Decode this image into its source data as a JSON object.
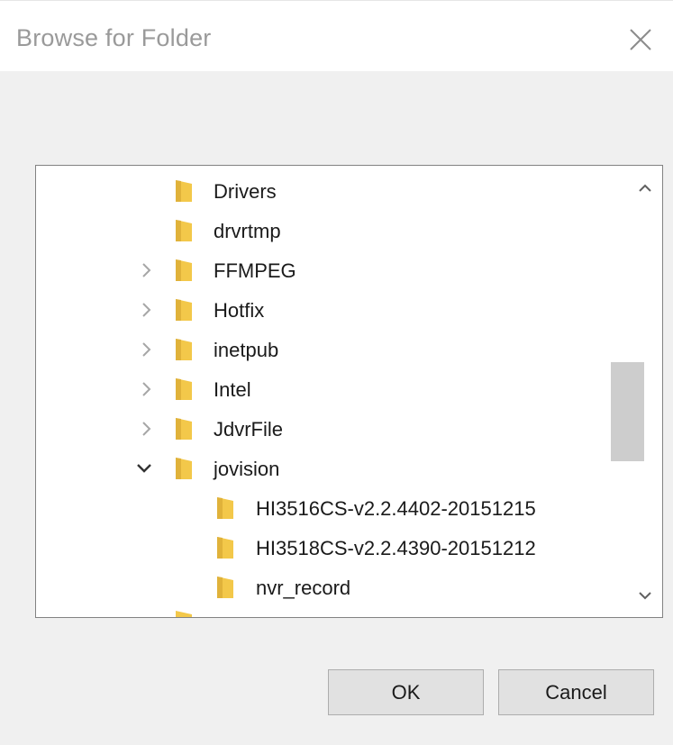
{
  "dialog": {
    "title": "Browse for Folder",
    "close_icon": "close-icon"
  },
  "tree": {
    "items": [
      {
        "label": "Drivers",
        "expander": "none"
      },
      {
        "label": "drvrtmp",
        "expander": "none"
      },
      {
        "label": "FFMPEG",
        "expander": "collapsed"
      },
      {
        "label": "Hotfix",
        "expander": "collapsed"
      },
      {
        "label": "inetpub",
        "expander": "collapsed"
      },
      {
        "label": "Intel",
        "expander": "collapsed"
      },
      {
        "label": "JdvrFile",
        "expander": "collapsed"
      },
      {
        "label": "jovision",
        "expander": "expanded"
      },
      {
        "label": "HI3516CS-v2.2.4402-20151215",
        "expander": "none"
      },
      {
        "label": "HI3518CS-v2.2.4390-20151212",
        "expander": "none"
      },
      {
        "label": "nvr_record",
        "expander": "none"
      }
    ]
  },
  "buttons": {
    "ok_label": "OK",
    "cancel_label": "Cancel"
  },
  "colors": {
    "folder": "#f3c84a",
    "title_text": "#9a9a9a",
    "dialog_bg": "#f0f0f0",
    "button_bg": "#e1e1e1",
    "scroll_thumb": "#cdcdcd"
  }
}
